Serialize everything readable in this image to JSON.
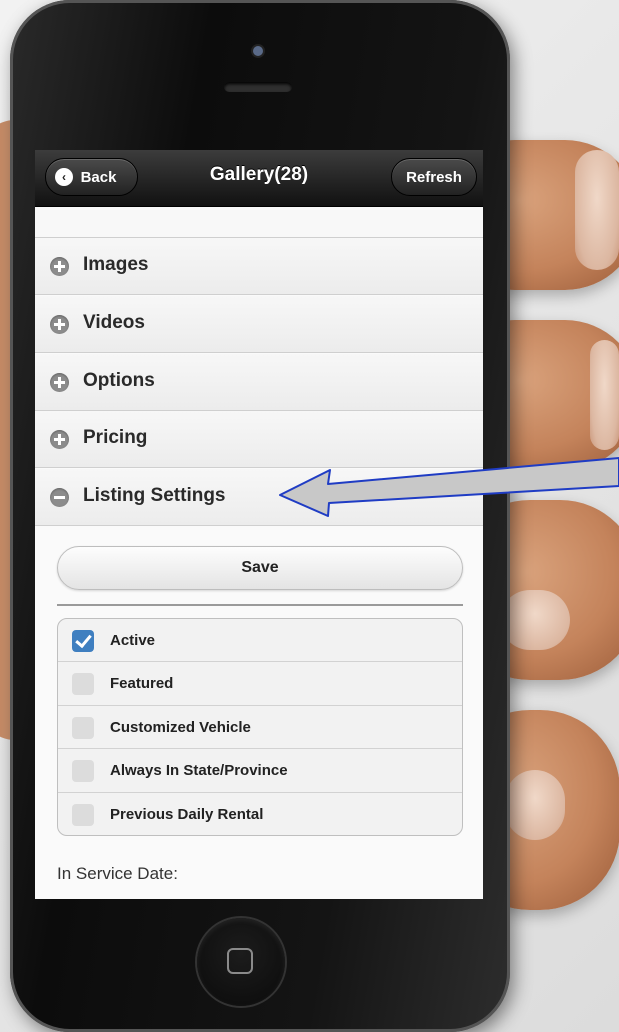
{
  "header": {
    "back_label": "Back",
    "title": "Gallery(28)",
    "refresh_label": "Refresh"
  },
  "sections": [
    {
      "label": "Images",
      "expanded": false
    },
    {
      "label": "Videos",
      "expanded": false
    },
    {
      "label": "Options",
      "expanded": false
    },
    {
      "label": "Pricing",
      "expanded": false
    },
    {
      "label": "Listing Settings",
      "expanded": true
    }
  ],
  "listing_settings": {
    "save_label": "Save",
    "checkboxes": [
      {
        "label": "Active",
        "checked": true
      },
      {
        "label": "Featured",
        "checked": false
      },
      {
        "label": "Customized Vehicle",
        "checked": false
      },
      {
        "label": "Always In State/Province",
        "checked": false
      },
      {
        "label": "Previous Daily Rental",
        "checked": false
      }
    ],
    "in_service_label": "In Service Date:"
  },
  "colors": {
    "header_bg": "#1a1a1a",
    "checkbox_checked": "#3f7fc0",
    "arrow_fill": "#c8c8c8",
    "arrow_stroke": "#1f3cc4"
  }
}
